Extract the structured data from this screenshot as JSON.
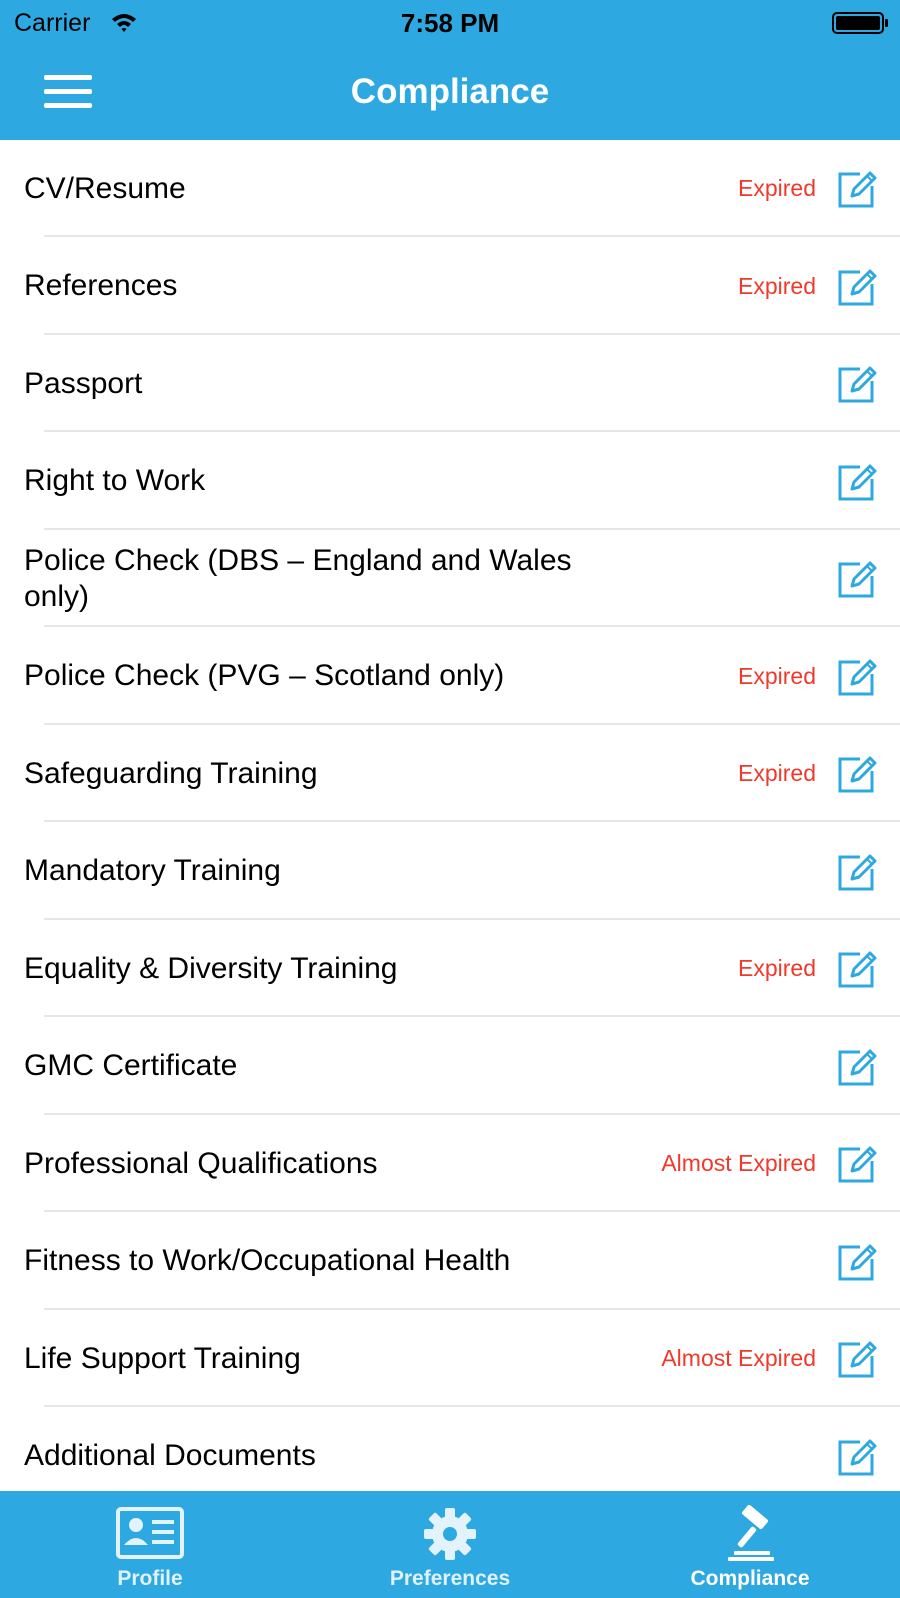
{
  "status_bar": {
    "carrier": "Carrier",
    "time": "7:58 PM",
    "icons": [
      "wifi-icon",
      "battery-icon"
    ]
  },
  "nav": {
    "title": "Compliance",
    "menu_icon": "hamburger-menu-icon"
  },
  "colors": {
    "accent": "#2ea8e0",
    "status_red": "#f0392b",
    "separator": "#e6e6e6"
  },
  "items": [
    {
      "label": "CV/Resume",
      "status": "Expired"
    },
    {
      "label": "References",
      "status": "Expired"
    },
    {
      "label": "Passport",
      "status": ""
    },
    {
      "label": "Right to Work",
      "status": ""
    },
    {
      "label": "Police Check (DBS – England and Wales only)",
      "status": ""
    },
    {
      "label": "Police Check (PVG – Scotland only)",
      "status": "Expired"
    },
    {
      "label": "Safeguarding Training",
      "status": "Expired"
    },
    {
      "label": "Mandatory Training",
      "status": ""
    },
    {
      "label": "Equality & Diversity Training",
      "status": "Expired"
    },
    {
      "label": "GMC Certificate",
      "status": ""
    },
    {
      "label": "Professional Qualifications",
      "status": "Almost Expired"
    },
    {
      "label": "Fitness to Work/Occupational Health",
      "status": ""
    },
    {
      "label": "Life Support Training",
      "status": "Almost Expired"
    },
    {
      "label": "Additional Documents",
      "status": ""
    }
  ],
  "tabs": [
    {
      "label": "Profile",
      "icon": "id-card-icon",
      "active": false
    },
    {
      "label": "Preferences",
      "icon": "gear-icon",
      "active": false
    },
    {
      "label": "Compliance",
      "icon": "gavel-icon",
      "active": true
    }
  ]
}
